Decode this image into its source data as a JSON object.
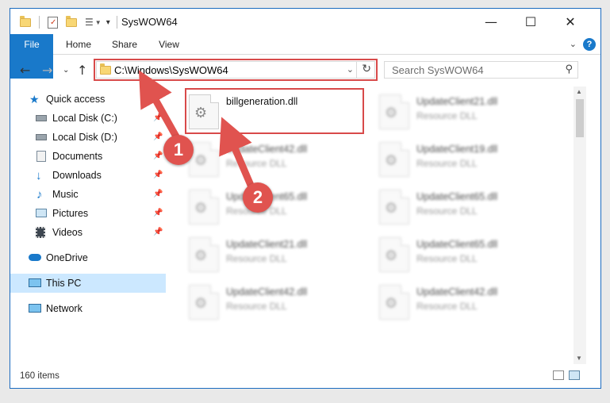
{
  "window": {
    "title": "SysWOW64"
  },
  "ribbon": {
    "tabs": [
      "File",
      "Home",
      "Share",
      "View"
    ],
    "help_label": "?"
  },
  "nav": {
    "address": "C:\\Windows\\SysWOW64",
    "search_placeholder": "Search SysWOW64"
  },
  "sidebar": {
    "items": [
      {
        "label": "Quick access",
        "icon": "star-icon"
      },
      {
        "label": "Local Disk (C:)",
        "icon": "drive-icon",
        "pinned": true
      },
      {
        "label": "Local Disk (D:)",
        "icon": "drive-icon",
        "pinned": true
      },
      {
        "label": "Documents",
        "icon": "documents-icon",
        "pinned": true
      },
      {
        "label": "Downloads",
        "icon": "download-icon",
        "pinned": true
      },
      {
        "label": "Music",
        "icon": "music-icon",
        "pinned": true
      },
      {
        "label": "Pictures",
        "icon": "pictures-icon",
        "pinned": true
      },
      {
        "label": "Videos",
        "icon": "video-icon",
        "pinned": true
      },
      {
        "label": "OneDrive",
        "icon": "cloud-icon"
      },
      {
        "label": "This PC",
        "icon": "computer-icon",
        "selected": true
      },
      {
        "label": "Network",
        "icon": "network-icon"
      }
    ]
  },
  "files": [
    {
      "name": "billgeneration.dll",
      "type": ""
    },
    {
      "name": "UpdateClient21.dll",
      "type": "Resource DLL"
    },
    {
      "name": "UpdateClient42.dll",
      "type": "Resource DLL"
    },
    {
      "name": "UpdateClient19.dll",
      "type": "Resource DLL"
    },
    {
      "name": "UpdateClient65.dll",
      "type": "Resource DLL"
    },
    {
      "name": "UpdateClient65.dll",
      "type": "Resource DLL"
    },
    {
      "name": "UpdateClient21.dll",
      "type": "Resource DLL"
    },
    {
      "name": "UpdateClient65.dll",
      "type": "Resource DLL"
    },
    {
      "name": "UpdateClient42.dll",
      "type": "Resource DLL"
    },
    {
      "name": "UpdateClient42.dll",
      "type": "Resource DLL"
    }
  ],
  "status": {
    "item_count": "160 items"
  },
  "annotations": {
    "step1": "1",
    "step2": "2",
    "color": "#e0534f"
  }
}
